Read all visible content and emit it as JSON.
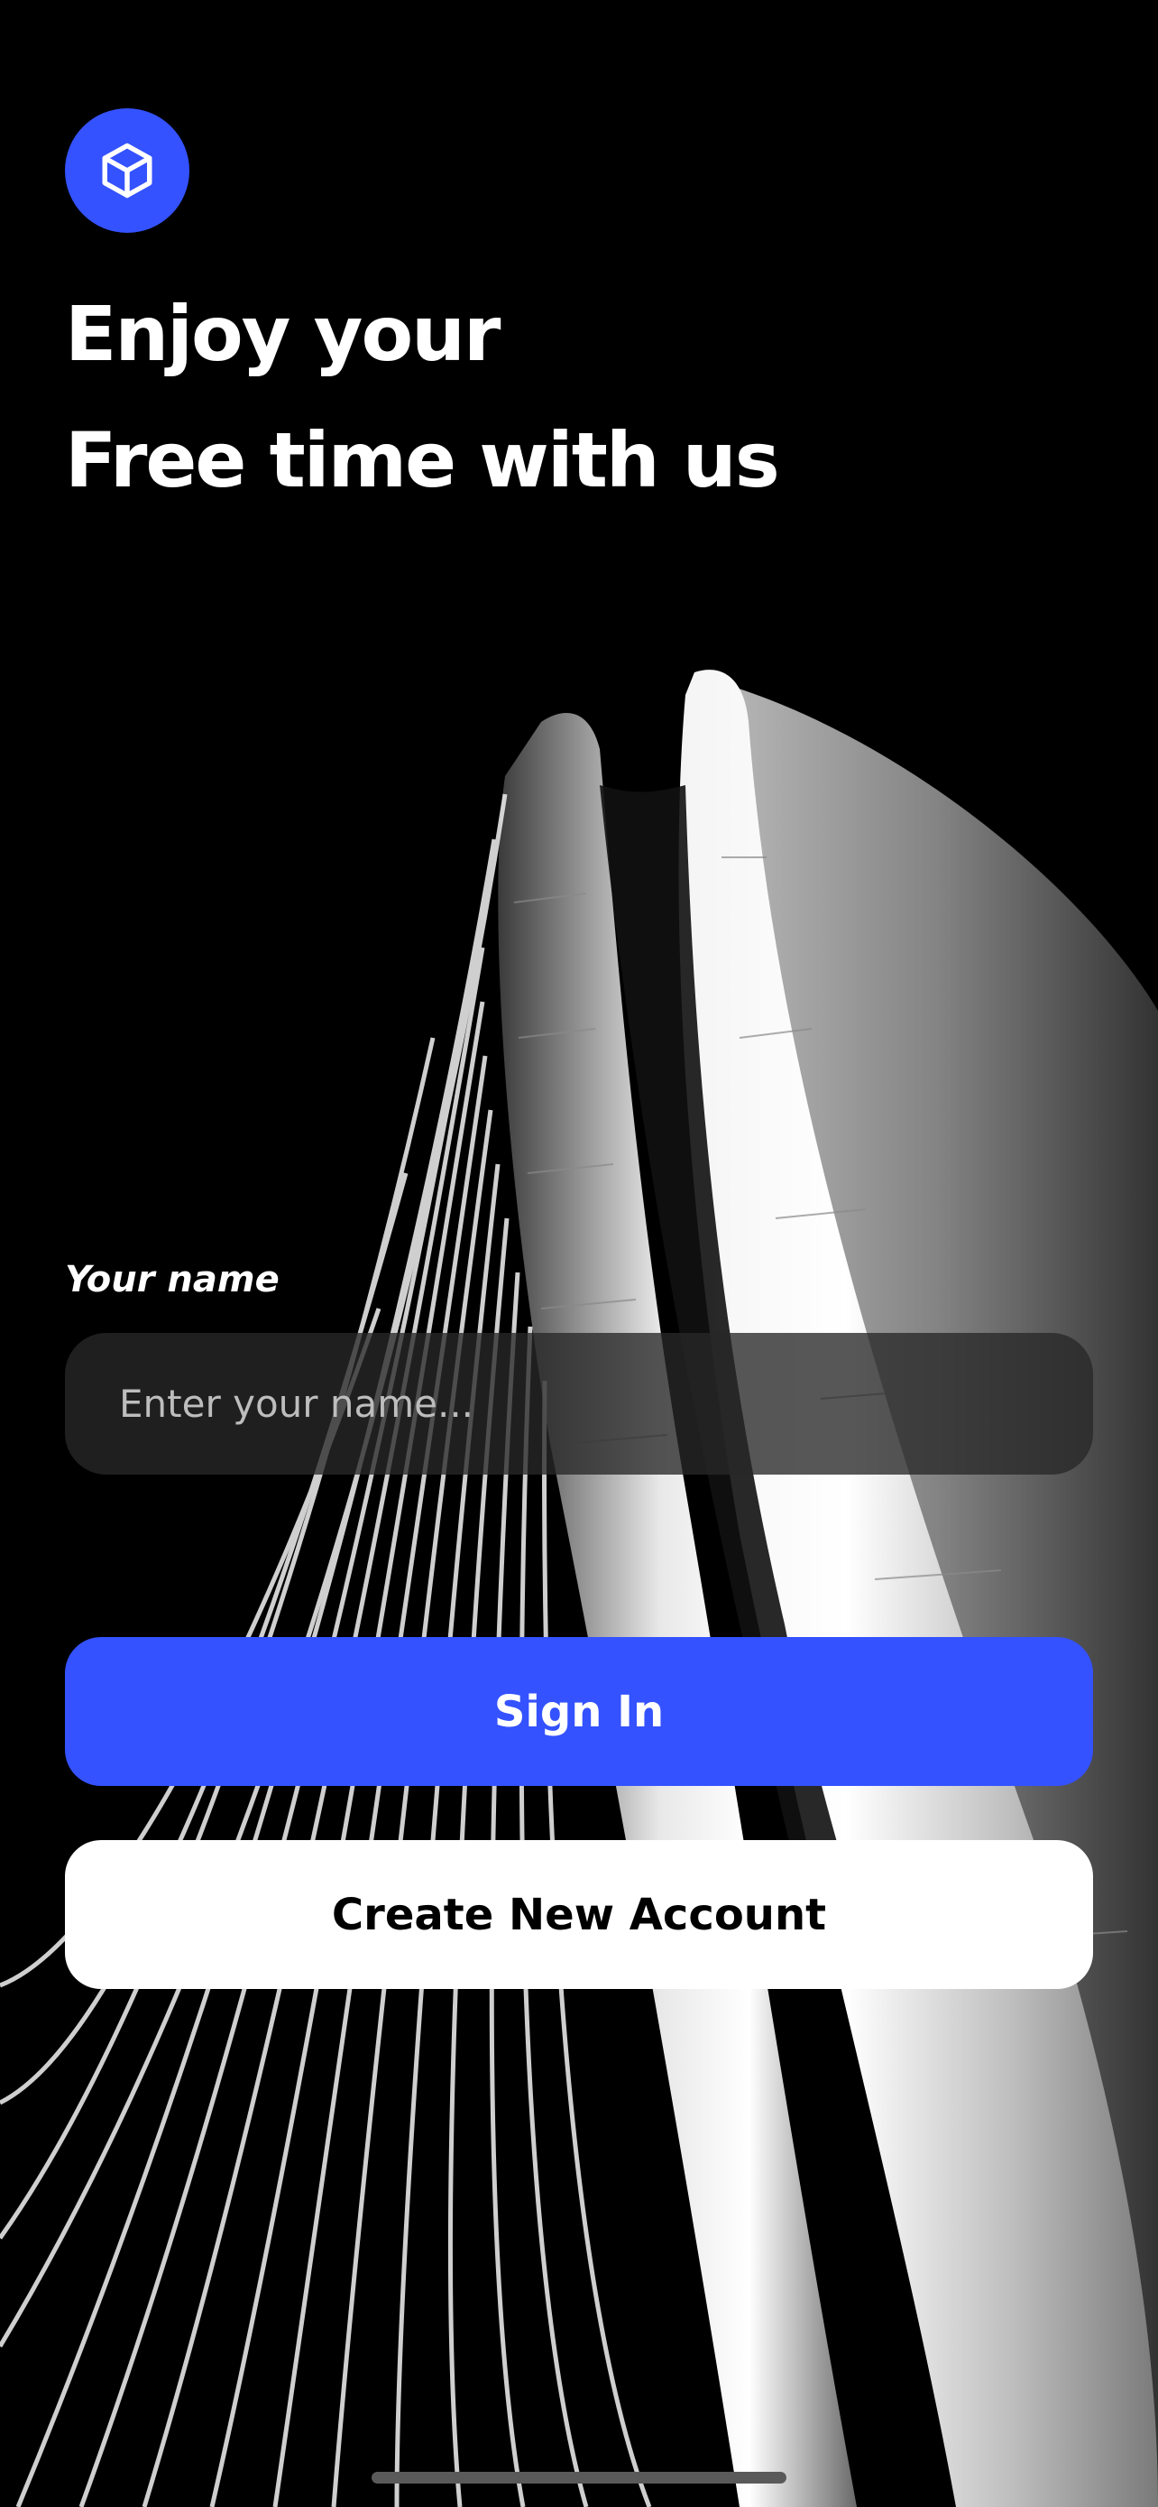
{
  "app": {
    "accent_color": "#3452ff"
  },
  "logo": {
    "icon": "cube-icon"
  },
  "headline": {
    "line1": "Enjoy your",
    "line2": "Free time with us"
  },
  "form": {
    "name_label": "Your name",
    "name_placeholder": "Enter your name...",
    "name_value": ""
  },
  "actions": {
    "sign_in_label": "Sign In",
    "create_account_label": "Create New Account"
  }
}
